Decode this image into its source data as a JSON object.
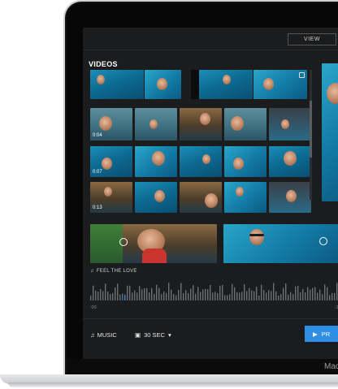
{
  "header": {
    "view_label": "VIEW"
  },
  "videos": {
    "title": "VIDEOS",
    "rows": [
      {
        "duration": ""
      },
      {
        "duration": "0:04"
      },
      {
        "duration": "0:07"
      },
      {
        "duration": "0:13"
      }
    ]
  },
  "timeline": {
    "track_label": "FEEL THE LOVE",
    "start_time": ":00",
    "end_time": ":1"
  },
  "footer": {
    "music_label": "MUSIC",
    "duration_label": "30 SEC",
    "primary_label": "PR"
  },
  "device": {
    "label": "Mac"
  },
  "colors": {
    "accent": "#2f8fe4",
    "screen_bg": "#1b1c1e"
  }
}
